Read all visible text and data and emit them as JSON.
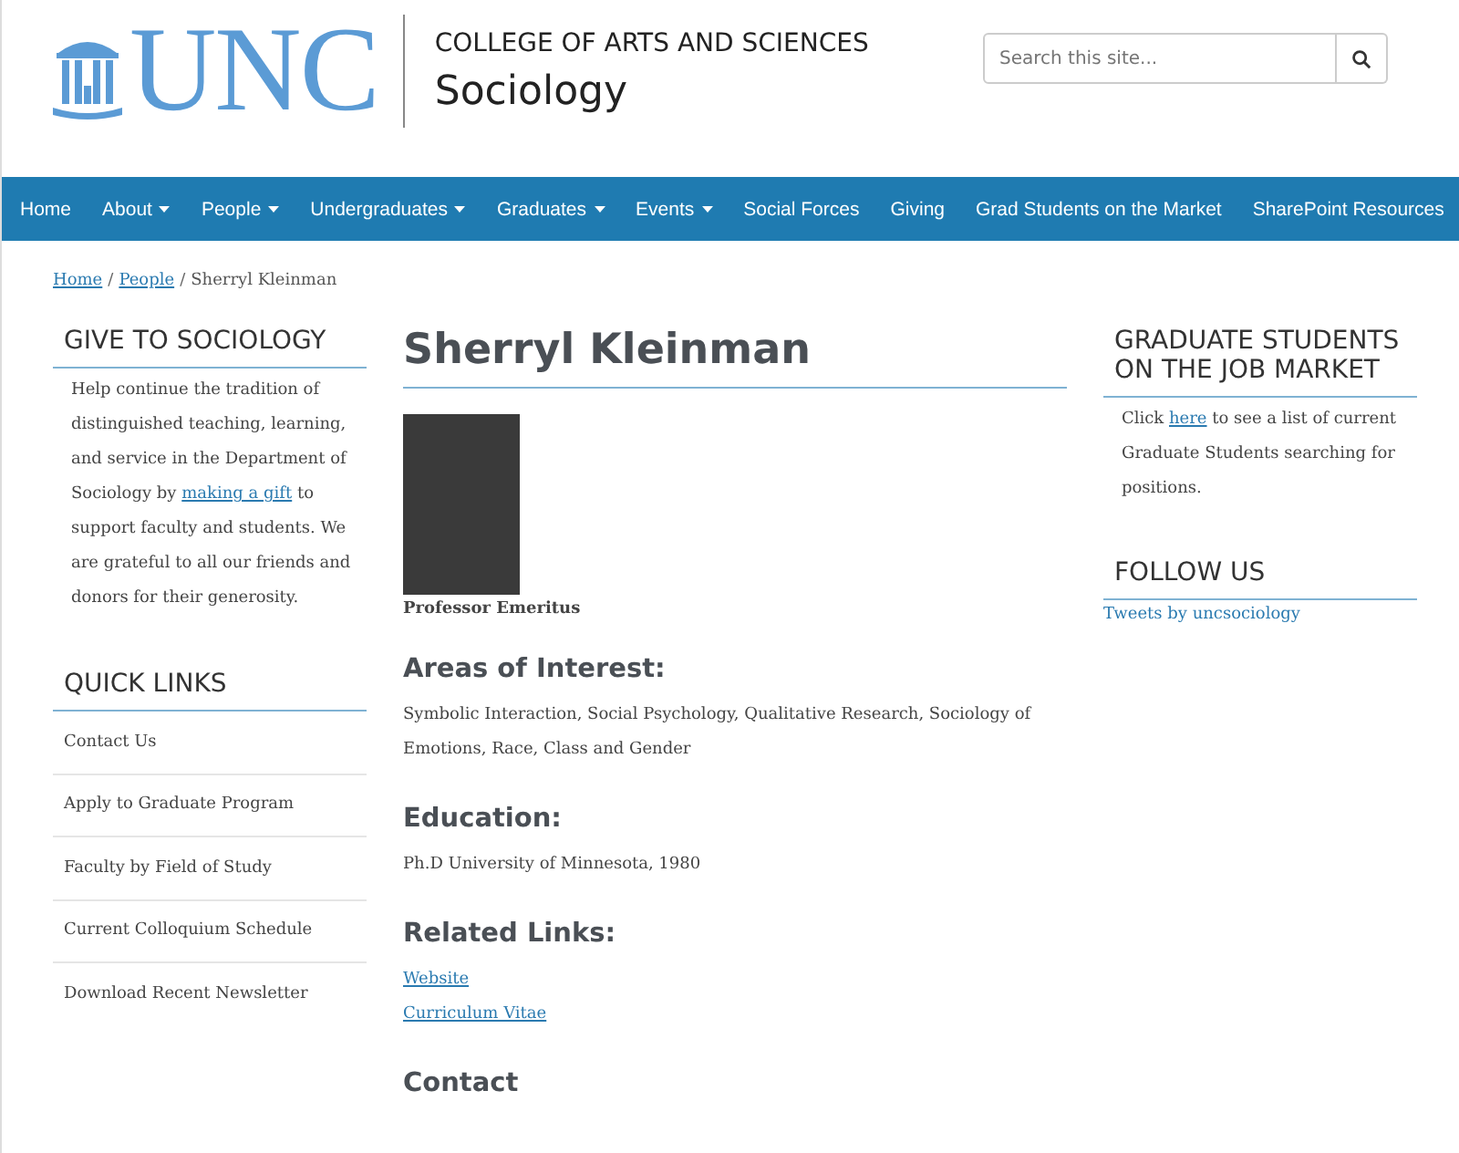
{
  "header": {
    "logo_text": "UNC",
    "college": "COLLEGE OF ARTS AND SCIENCES",
    "department": "Sociology",
    "search": {
      "placeholder": "Search this site..."
    }
  },
  "nav": [
    {
      "label": "Home",
      "dropdown": false
    },
    {
      "label": "About",
      "dropdown": true
    },
    {
      "label": "People",
      "dropdown": true
    },
    {
      "label": "Undergraduates",
      "dropdown": true
    },
    {
      "label": "Graduates",
      "dropdown": true
    },
    {
      "label": "Events",
      "dropdown": true
    },
    {
      "label": "Social Forces",
      "dropdown": false
    },
    {
      "label": "Giving",
      "dropdown": false
    },
    {
      "label": "Grad Students on the Market",
      "dropdown": false
    },
    {
      "label": "SharePoint Resources",
      "dropdown": false
    }
  ],
  "breadcrumb": {
    "separator": "/",
    "items": [
      {
        "text": "Home",
        "link": true
      },
      {
        "text": "People",
        "link": true
      },
      {
        "text": "Sherryl Kleinman",
        "link": false
      }
    ]
  },
  "left": {
    "give": {
      "title": "GIVE TO SOCIOLOGY",
      "parts": [
        {
          "text": "Help continue the tradition of distinguished teaching, learning, and service in the Department of Sociology by ",
          "link": false
        },
        {
          "text": "making a gift",
          "link": true
        },
        {
          "text": " to support faculty and students. We are grateful to all our friends and donors for their generosity.",
          "link": false
        }
      ]
    },
    "quick_links": {
      "title": "QUICK LINKS",
      "items": [
        "Contact Us",
        "Apply to Graduate Program",
        "Faculty by Field of Study",
        "Current Colloquium Schedule",
        "Download Recent Newsletter"
      ]
    }
  },
  "profile": {
    "name": "Sherryl Kleinman",
    "title": "Professor Emeritus",
    "sections": [
      {
        "heading": "Areas of Interest:",
        "kind": "text",
        "text": "Symbolic Interaction, Social Psychology, Qualitative Research, Sociology of Emotions, Race, Class and Gender"
      },
      {
        "heading": "Education:",
        "kind": "text",
        "text": "Ph.D University of Minnesota, 1980"
      },
      {
        "heading": "Related Links:",
        "kind": "links",
        "links": [
          "Website",
          "Curriculum Vitae"
        ]
      },
      {
        "heading": "Contact",
        "kind": "heading"
      }
    ]
  },
  "right": {
    "job_market": {
      "title": "GRADUATE STUDENTS ON THE JOB MARKET",
      "parts": [
        {
          "text": "Click ",
          "link": false
        },
        {
          "text": "here",
          "link": true
        },
        {
          "text": " to see a list of current Graduate Students searching for positions.",
          "link": false
        }
      ]
    },
    "follow": {
      "title": "FOLLOW US",
      "link": "Tweets by uncsociology"
    }
  }
}
